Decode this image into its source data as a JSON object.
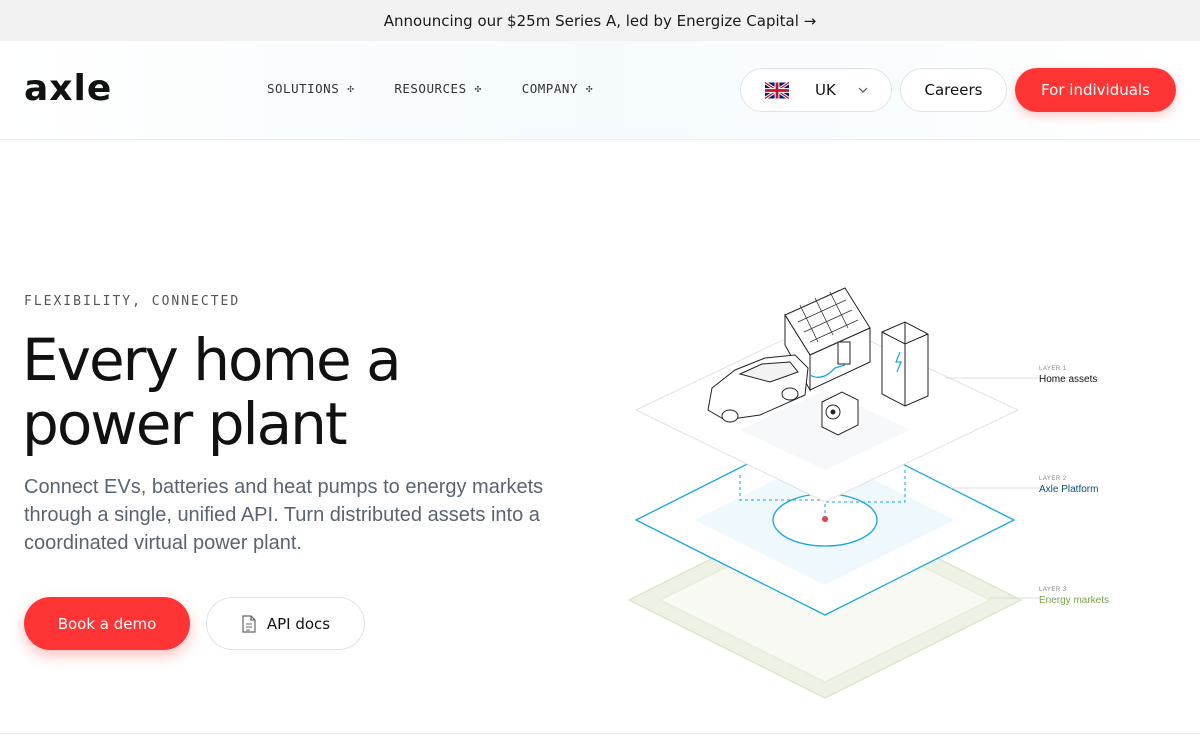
{
  "announcement": {
    "text": "Announcing our $25m Series A, led by Energize Capital →"
  },
  "header": {
    "logo": "axle",
    "nav": [
      {
        "label": "SOLUTIONS"
      },
      {
        "label": "RESOURCES"
      },
      {
        "label": "COMPANY"
      }
    ],
    "country": {
      "label": "UK",
      "flag_icon": "uk-flag-icon"
    },
    "careers_label": "Careers",
    "individuals_label": "For individuals"
  },
  "hero": {
    "eyebrow": "FLEXIBILITY, CONNECTED",
    "headline_line1": "Every home a",
    "headline_line2": "power plant",
    "subtext": "Connect EVs, batteries and heat pumps to energy markets through a single, unified API. Turn distributed assets into a coordinated virtual power plant.",
    "demo_label": "Book a demo",
    "docs_label": "API docs"
  },
  "diagram": {
    "layers": [
      {
        "tag": "LAYER 1",
        "name": "Home assets",
        "color": "#111111"
      },
      {
        "tag": "LAYER 2",
        "name": "Axle Platform",
        "color": "#0b4f6c"
      },
      {
        "tag": "LAYER 3",
        "name": "Energy markets",
        "color": "#7aa34a"
      }
    ]
  },
  "colors": {
    "accent": "#ff3535",
    "platform_blue": "#1aa6e0",
    "market_green": "#dfe8cf"
  }
}
